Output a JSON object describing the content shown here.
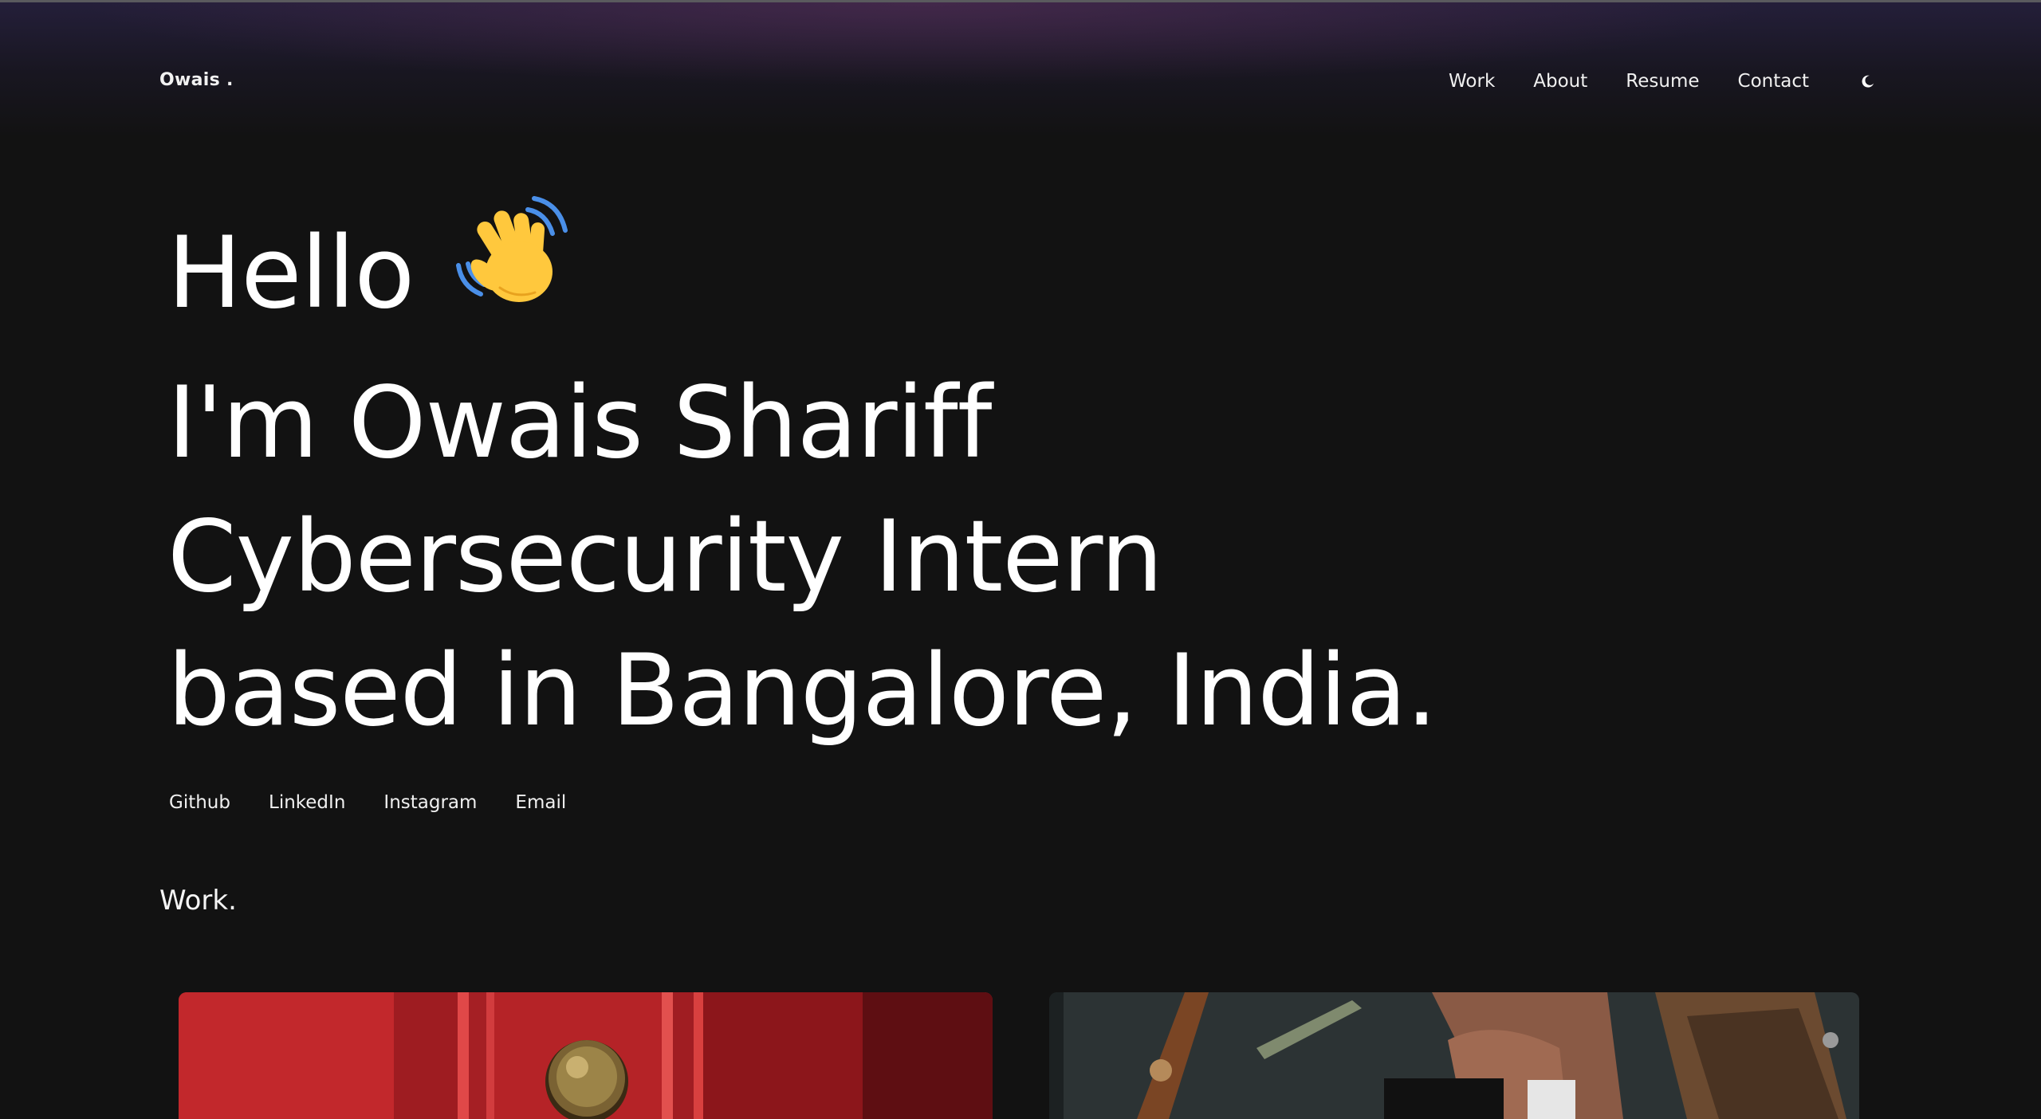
{
  "nav": {
    "logo": "Owais .",
    "links": [
      "Work",
      "About",
      "Resume",
      "Contact"
    ],
    "theme_toggle_icon": "moon-icon"
  },
  "hero": {
    "line1": "Hello",
    "wave_icon": "waving-hand-icon",
    "line2": "I'm Owais Shariff",
    "line3": "Cybersecurity Intern",
    "line4": "based in Bangalore, India."
  },
  "socials": [
    "Github",
    "LinkedIn",
    "Instagram",
    "Email"
  ],
  "work": {
    "title": "Work.",
    "cards": [
      {
        "image": "red-door-with-knob-image"
      },
      {
        "image": "hands-holding-wallet-card-image"
      }
    ]
  },
  "colors": {
    "background": "#121212",
    "text": "#ffffff",
    "header_glow_purple": "#5c3058",
    "header_glow_blue": "#26203e"
  }
}
